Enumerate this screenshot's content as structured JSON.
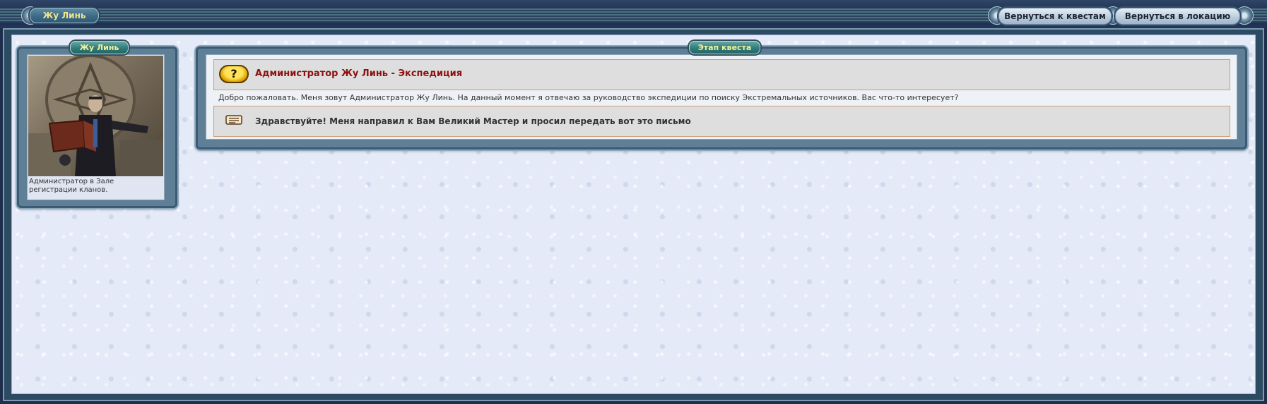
{
  "header": {
    "title": "Жу Линь",
    "buttons": {
      "back_to_quests": "Вернуться к квестам",
      "back_to_location": "Вернуться в локацию"
    }
  },
  "npc": {
    "tab_label": "Жу Линь",
    "caption": "Администратор в Зале регистрации кланов."
  },
  "quest": {
    "tab_label": "Этап квеста",
    "title": "Администратор Жу Линь - Экспедиция",
    "text": "Добро пожаловать. Меня зовут Администратор Жу Линь. На данный момент я отвечаю за руководство экспедиции по поиску Экстремальных источников. Вас что-то интересует?",
    "reply": "Здравствуйте! Меня направил к Вам Великий Мастер и просил передать вот это письмо"
  },
  "icons": {
    "quest": "question-mark-icon",
    "reply": "letter-icon"
  },
  "colors": {
    "title_red": "#8e1111",
    "tab_teal": "#2f7c7a",
    "tab_text": "#f6ef9c"
  }
}
